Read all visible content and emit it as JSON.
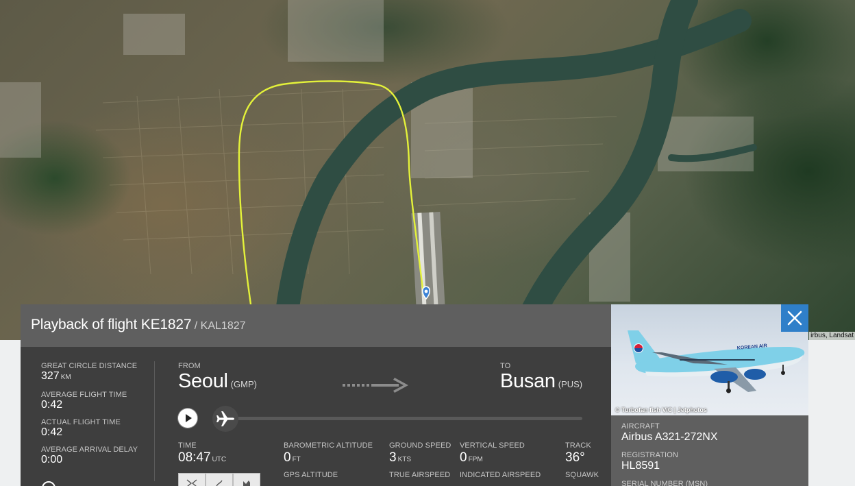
{
  "map": {
    "attribution": "irbus, Landsat"
  },
  "panel": {
    "title": "Playback of flight KE1827",
    "callsign": "/ KAL1827",
    "stats": {
      "distance": {
        "label": "GREAT CIRCLE DISTANCE",
        "value": "327",
        "unit": "KM"
      },
      "avg_time": {
        "label": "AVERAGE FLIGHT TIME",
        "value": "0:42"
      },
      "actual_time": {
        "label": "ACTUAL FLIGHT TIME",
        "value": "0:42"
      },
      "avg_delay": {
        "label": "AVERAGE ARRIVAL DELAY",
        "value": "0:00"
      }
    },
    "from": {
      "label": "FROM",
      "city": "Seoul",
      "code": "(GMP)"
    },
    "to": {
      "label": "TO",
      "city": "Busan",
      "code": "(PUS)"
    },
    "timeline_progress": 0.0,
    "telemetry": {
      "time": {
        "label": "TIME",
        "value": "08:47",
        "unit": "UTC"
      },
      "baro_alt": {
        "label": "BAROMETRIC ALTITUDE",
        "value": "0",
        "unit": "FT"
      },
      "gps_alt": {
        "label": "GPS ALTITUDE"
      },
      "ground_speed": {
        "label": "GROUND SPEED",
        "value": "3",
        "unit": "KTS"
      },
      "true_airspeed": {
        "label": "TRUE AIRSPEED"
      },
      "vertical_speed": {
        "label": "VERTICAL SPEED",
        "value": "0",
        "unit": "FPM"
      },
      "indicated_airspeed": {
        "label": "INDICATED AIRSPEED"
      },
      "track": {
        "label": "TRACK",
        "value": "36°"
      },
      "squawk": {
        "label": "SQUAWK"
      }
    }
  },
  "aircraft": {
    "photo_credit": "© Turbofan fish ViC | Jetphotos",
    "livery_text": "KOREAN AIR",
    "type": {
      "label": "AIRCRAFT",
      "value": "Airbus A321-272NX"
    },
    "registration": {
      "label": "REGISTRATION",
      "value": "HL8591"
    },
    "serial": {
      "label": "SERIAL NUMBER (MSN)"
    }
  },
  "colors": {
    "track_line": "#e4f23a",
    "header_bg": "#5f5f5f",
    "panel_bg": "#3e3e3e",
    "close_button": "#2f7fc9",
    "aircraft_fuselage": "#7fd0e8"
  }
}
